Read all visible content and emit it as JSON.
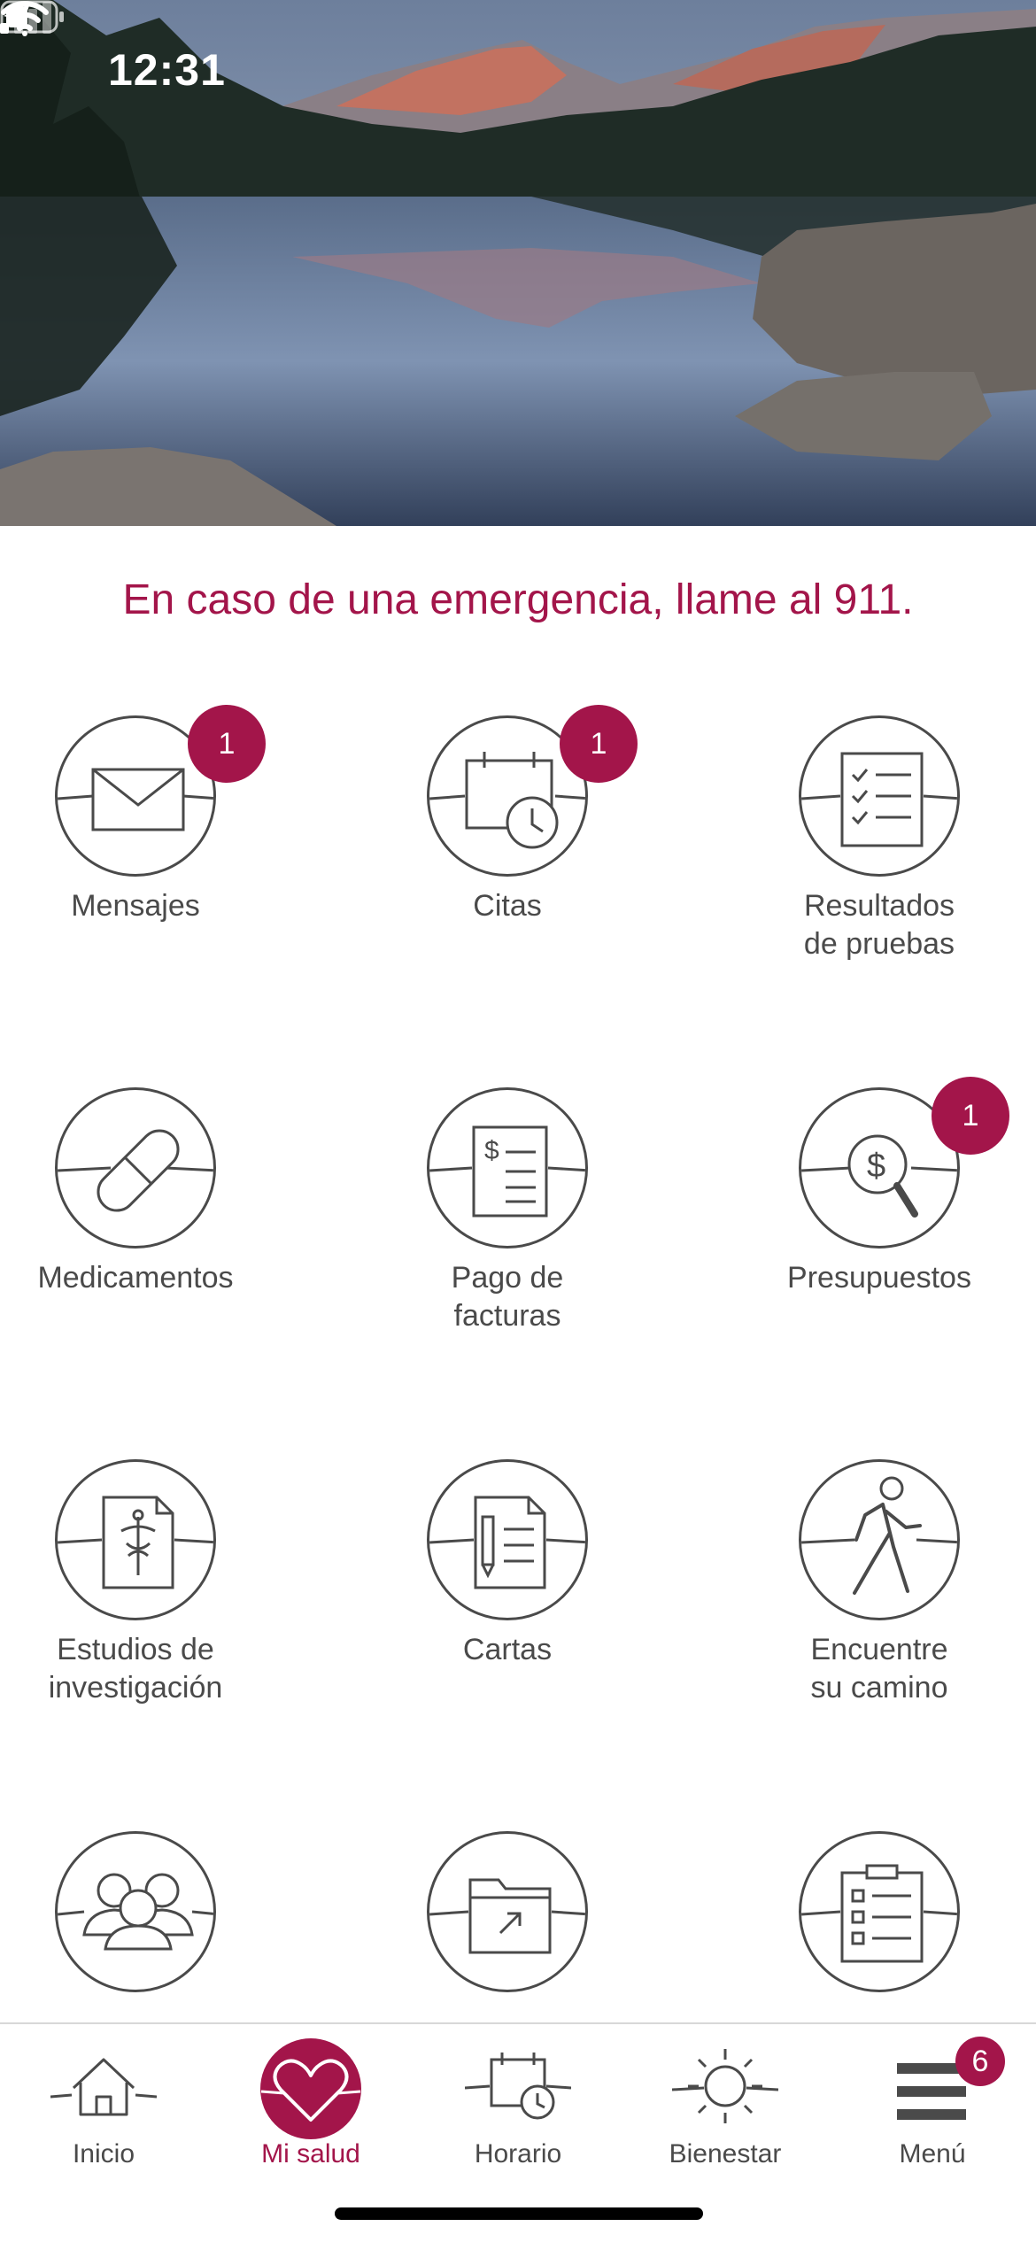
{
  "status_bar": {
    "time": "12:31"
  },
  "emergency_text": "En caso de una emergencia, llame al 911.",
  "tiles": [
    {
      "label": "Mensajes",
      "icon": "envelope-icon",
      "badge": "1"
    },
    {
      "label": "Citas",
      "icon": "calendar-clock-icon",
      "badge": "1"
    },
    {
      "label": "Resultados\nde pruebas",
      "icon": "checklist-icon",
      "badge": ""
    },
    {
      "label": "Medicamentos",
      "icon": "pill-capsule-icon",
      "badge": ""
    },
    {
      "label": "Pago de\nfacturas",
      "icon": "bill-dollar-icon",
      "badge": ""
    },
    {
      "label": "Presupuestos",
      "icon": "dollar-magnifier-icon",
      "badge": "1"
    },
    {
      "label": "Estudios de\ninvestigación",
      "icon": "caduceus-document-icon",
      "badge": ""
    },
    {
      "label": "Cartas",
      "icon": "letter-pen-icon",
      "badge": ""
    },
    {
      "label": "Encuentre\nsu camino",
      "icon": "walking-person-icon",
      "badge": ""
    },
    {
      "label": "",
      "icon": "group-people-icon",
      "badge": ""
    },
    {
      "label": "",
      "icon": "folder-share-icon",
      "badge": ""
    },
    {
      "label": "",
      "icon": "clipboard-list-icon",
      "badge": ""
    }
  ],
  "tabs": [
    {
      "label": "Inicio",
      "icon": "house-icon"
    },
    {
      "label": "Mi salud",
      "icon": "heart-icon",
      "active": true
    },
    {
      "label": "Horario",
      "icon": "calendar-clock-icon"
    },
    {
      "label": "Bienestar",
      "icon": "sun-icon"
    },
    {
      "label": "Menú",
      "icon": "hamburger-menu-icon",
      "badge": "6"
    }
  ],
  "colors": {
    "accent": "#a3154a",
    "icon_stroke": "#4a4a4a",
    "text": "#4a4a4a"
  }
}
